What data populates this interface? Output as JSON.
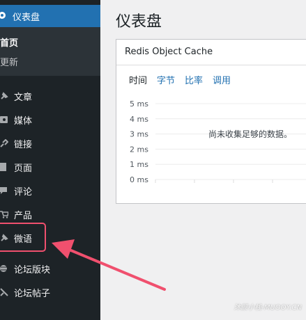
{
  "sidebar": {
    "dashboard_label": "仪表盘",
    "submenu": {
      "home": "首页",
      "updates": "更新"
    },
    "items": [
      {
        "label": "文章",
        "icon": "pin-icon"
      },
      {
        "label": "媒体",
        "icon": "media-icon"
      },
      {
        "label": "链接",
        "icon": "link-icon"
      },
      {
        "label": "页面",
        "icon": "page-icon"
      },
      {
        "label": "评论",
        "icon": "comment-icon"
      },
      {
        "label": "产品",
        "icon": "cart-icon"
      },
      {
        "label": "微语",
        "icon": "pin-icon"
      },
      {
        "label": "论坛版块",
        "icon": "forum-icon"
      },
      {
        "label": "论坛帖子",
        "icon": "tools-icon"
      }
    ]
  },
  "main": {
    "page_title": "仪表盘",
    "widget": {
      "title": "Redis Object Cache",
      "tabs": [
        "时间",
        "字节",
        "比率",
        "调用"
      ],
      "active_tab": "时间",
      "no_data_text": "尚未收集足够的数据。"
    }
  },
  "chart_data": {
    "type": "line",
    "y_tick_labels": [
      "5 ms",
      "4 ms",
      "3 ms",
      "2 ms",
      "1 ms",
      "0 ms"
    ],
    "ylim": [
      0,
      5
    ],
    "series": [],
    "grid": true
  },
  "colors": {
    "sidebar_bg": "#1d2327",
    "active_menu_bg": "#2271b1",
    "submenu_bg": "#2c3338",
    "link_blue": "#2271b1",
    "highlight_red": "#f0506e"
  },
  "watermark": "沐颜小栈-MUOOY.CN"
}
